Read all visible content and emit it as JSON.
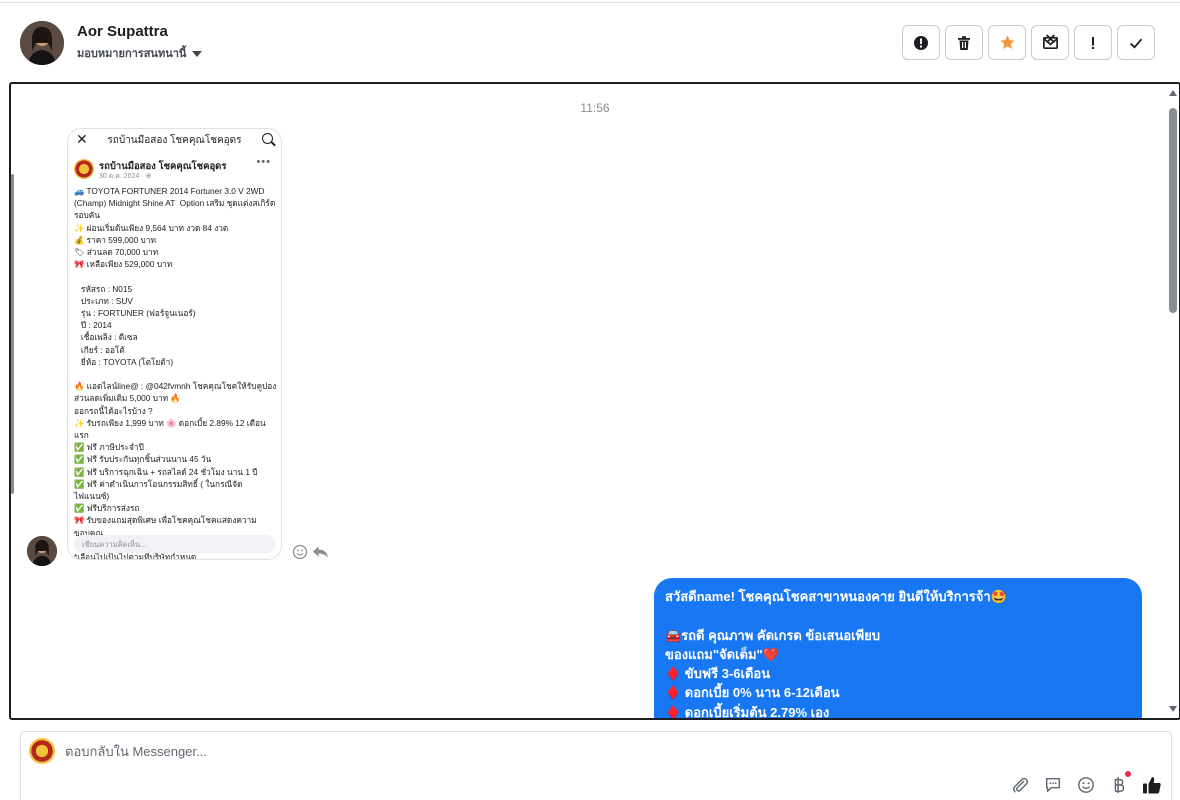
{
  "contact": {
    "name": "Aor Supattra",
    "assign_label": "มอบหมายการสนทนานี้"
  },
  "header_actions": [
    {
      "name": "spam",
      "icon": "alert-circle-icon"
    },
    {
      "name": "delete",
      "icon": "trash-icon"
    },
    {
      "name": "star",
      "icon": "star-icon",
      "color": "#f7923a"
    },
    {
      "name": "mark-unread",
      "icon": "envelope-x-icon"
    },
    {
      "name": "follow-up",
      "icon": "exclamation-icon"
    },
    {
      "name": "done",
      "icon": "check-icon"
    }
  ],
  "thread": {
    "timestamp": "11:56",
    "incoming_screenshot": {
      "top_title": "รถบ้านมือสอง โชคคุณโชคอุดร",
      "page_name": "รถบ้านมือสอง โชคคุณโชคอุดร",
      "date": "30 ต.ค. 2024 · ⊕",
      "body": "🚙 TOYOTA FORTUNER 2014 Fortuner 3.0 V 2WD\n(Champ) Midnight Shine AT  Option เสริม ชุดแต่งสเกิร์ต\nรอบคัน\n✨ ผ่อนเริ่มต้นเพียง 9,564 บาท งวด 84 งวด\n💰 ราคา 599,000 บาท\n🏷 ส่วนลด 70,000 บาท\n🎀 เหลือเพียง 529,000 บาท\n\n   รหัสรถ : N015\n   ประเภท : SUV\n   รุ่น : FORTUNER (ฟอร์จูนเนอร์)\n   ปี : 2014\n   เชื้อเพลิง : ดีเซล\n   เกียร์ : ออโต้\n   ยี่ห้อ : TOYOTA (โตโยต้า)\n\n🔥 แอดไลน์line@ : @042fvmnh โชคคุณโชคให้รับคูปอง\nส่วนลดเพิ่มเติม 5,000 บาท 🔥\nออกรถนี้ได้อะไรบ้าง ?\n✨ รับรถเพียง 1,999 บาท 🌸 ดอกเบี้ย 2.89% 12 เดือน\nแรก\n✅ ฟรี ภาษีประจำปี\n✅ ฟรี รับประกันทุกชิ้นส่วนนาน 45 วัน\n✅ ฟรี บริการฉุกเฉิน + รถสไลด์ 24 ชั่วโมง นาน 1 ปี\n✅ ฟรี ค่าดำเนินการโอนกรรมสิทธิ์ ( ในกรณีจัดไฟแนนซ์)\n✅ ฟรีบริการส่งรถ\n🎀 รับของแถมสุดพิเศษ เพื่อโชคคุณโชคแสดงความขอบคุณ\nความเป็น\n*เลื่อนไปเป็นไปตามที่บริษัทกำหนด",
      "comment_placeholder": "เขียนความคิดเห็น..."
    },
    "outgoing_message": "สวัสดีname! โชคคุณโชคสาขาหนองคาย ยินดีให้บริการจ้า🤩\n\n🚘รถดี คุณภาพ คัดเกรด ข้อเสนอเพียบ\nของแถม\"จัดเต็ม\"❤️\n♦️ ขับฟรี 3-6เดือน\n♦️ ดอกเบี้ย 0% นาน 6-12เดือน\n♦️ ดอกเบี้ยเริ่มต้น 2.79% เอง"
  },
  "composer": {
    "placeholder": "ตอบกลับใน Messenger..."
  },
  "colors": {
    "accent": "#1877f2",
    "star": "#f7923a",
    "notification": "#f02849"
  }
}
